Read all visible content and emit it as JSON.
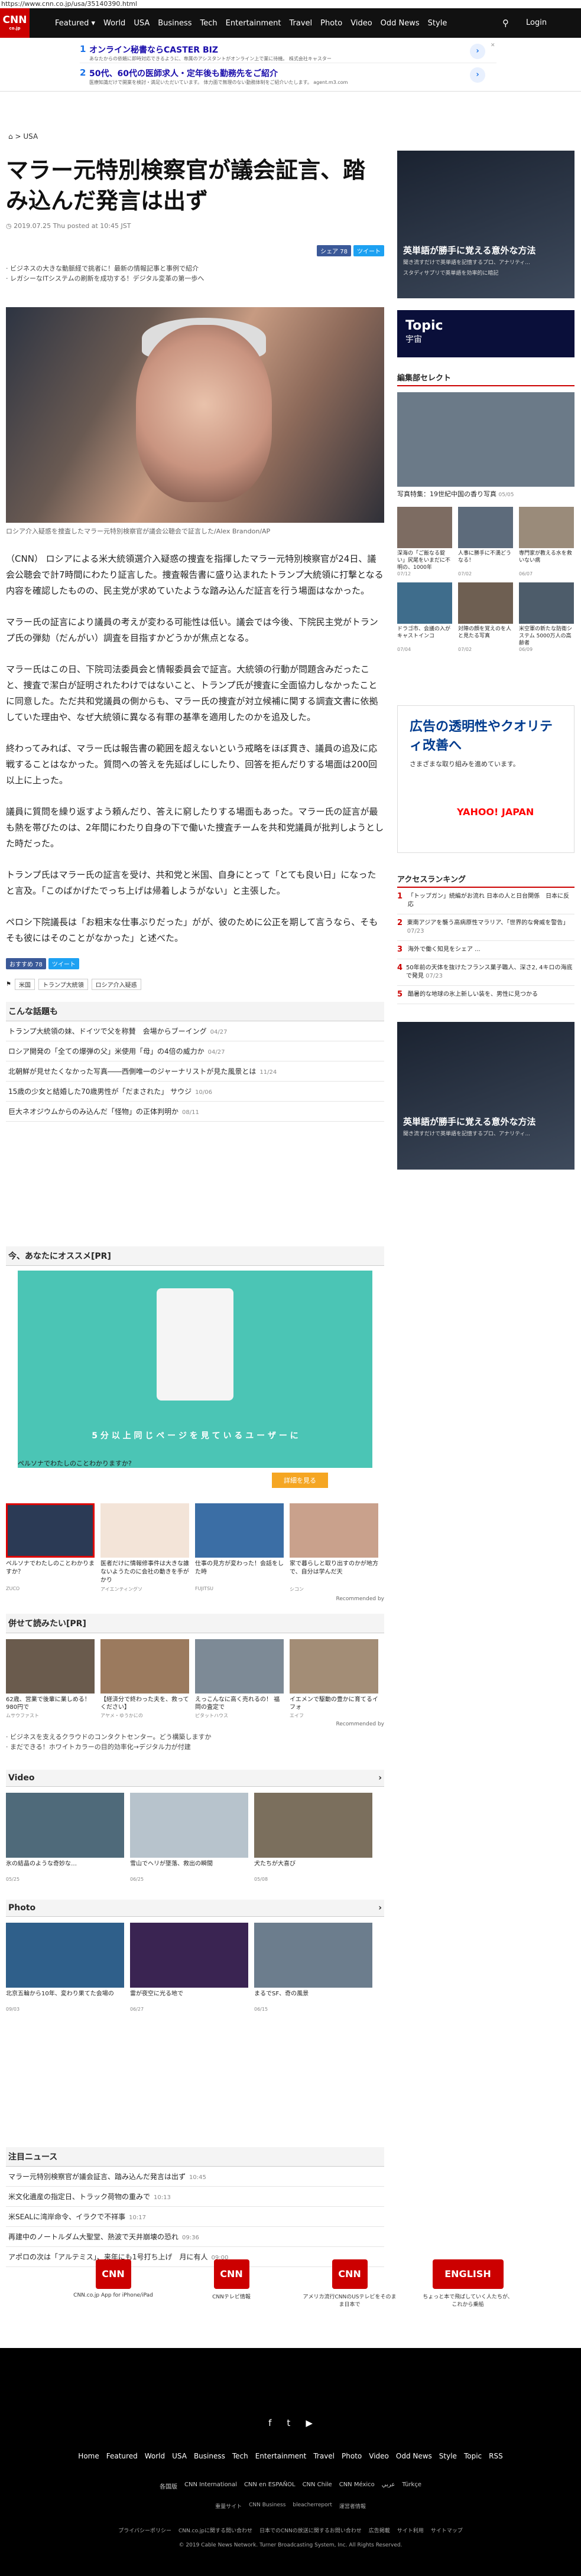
{
  "browser": {
    "url": "https://www.cnn.co.jp/usa/35140390.html"
  },
  "nav": {
    "logo": "CNN",
    "logo_sub": "co.jp",
    "items": [
      "Featured ▾",
      "World",
      "USA",
      "Business",
      "Tech",
      "Entertainment",
      "Travel",
      "Photo",
      "Video",
      "Odd News",
      "Style"
    ],
    "login": "Login"
  },
  "ads_top": [
    {
      "num": "1",
      "title": "オンライン秘書ならCASTER BIZ",
      "sub": "あなたからの依頼に即時対応できるように、専属のアシスタントがオンライン上で業に待機。 株式会社キャスター"
    },
    {
      "num": "2",
      "title": "50代、60代の医師求人・定年後も勤務先をご紹介",
      "sub": "医療知識だけで開業を検討・満足いただいています。 体力面で無理のない勤務体制をご紹介いたします。 agent.m3.com"
    }
  ],
  "breadcrumb": "USA",
  "article": {
    "headline": "マラー元特別検察官が議会証言、踏み込んだ発言は出ず",
    "dateline": "2019.07.25 Thu posted at 10:45 JST",
    "share_fb": "シェア 78",
    "share_tw": "ツイート",
    "bullets": [
      "ビジネスの大きな動脈経で挑者に！最新の情報記事と事例で紹介",
      "レガシーなITシステムの刷新を成功する！デジタル変革の第一歩へ"
    ],
    "caption": "ロシア介入疑惑を捜査したマラー元特別検察官が議会公聴会で証言した/Alex Brandon/AP",
    "paragraphs": [
      "（CNN） ロシアによる米大統領選介入疑惑の捜査を指揮したマラー元特別検察官が24日、議会公聴会で計7時間にわたり証言した。捜査報告書に盛り込まれたトランプ大統領に打撃となる内容を確認したものの、民主党が求めていたような踏み込んだ証言を行う場面はなかった。",
      "マラー氏の証言により議員の考えが変わる可能性は低い。議会では今後、下院民主党がトランプ氏の弾劾（だんがい）調査を目指すかどうかが焦点となる。",
      "マラー氏はこの日、下院司法委員会と情報委員会で証言。大統領の行動が問題含みだったこと、捜査で潔白が証明されたわけではないこと、トランプ氏が捜査に全面協力しなかったことに同意した。ただ共和党議員の側からも、マラー氏の捜査が対立候補に関する調査文書に依拠していた理由や、なぜ大統領に異なる有罪の基準を適用したのかを追及した。",
      "終わってみれば、マラー氏は報告書の範囲を超えないという戒略をほぼ貫き、議員の追及に応戦することはなかった。質問への答えを先延ばしにしたり、回答を拒んだりする場面は200回以上に上った。",
      "議員に質問を繰り返すよう頼んだり、答えに窮したりする場面もあった。マラー氏の証言が最も熱を帯びたのは、2年間にわたり自身の下で働いた捜査チームを共和党議員が批判しようとした時だった。",
      "トランプ氏はマラー氏の証言を受け、共和党と米国、自身にとって「とても良い日」になったと言及。「このばかげたでっち上げは帰着しようがない」と主張した。",
      "ペロシ下院議長は「お粗末な仕事ぶりだった」がが、彼のために公正を期して言うなら、そもそも彼にはそのことがなかった」と述べた。"
    ],
    "share_fb2": "おすすめ 78",
    "share_tw2": "ツイート",
    "tags": [
      "米国",
      "トランプ大統領",
      "ロシア介入疑惑"
    ]
  },
  "related": {
    "title": "こんな話題も",
    "items": [
      {
        "t": "トランプ大統領の妹、ドイツで父を称賛　会場からブーイング",
        "time": "04/27"
      },
      {
        "t": "ロシア開発の「全ての爆弾の父」米使用「母」の4倍の威力か",
        "time": "04/27"
      },
      {
        "t": "北朝鮮が見せたくなかった写真――西側唯一のジャーナリストが見た風景とは",
        "time": "11/24"
      },
      {
        "t": "15歳の少女と結婚した70歳男性が「だまされた」 サウジ",
        "time": "10/06"
      },
      {
        "t": "巨大ネオジウムからのみ込んだ「怪物」の正体判明か",
        "time": "08/11"
      }
    ]
  },
  "reco": {
    "title": "今、あなたにオススメ[PR]",
    "ad_band": "5 分 以 上 同 じ ペ ー ジ を 見 て い る ユ ー ザ ー に",
    "ad_q": "ペルソナでわたしのことわかりますか?",
    "ad_btn": "詳細を見る",
    "cards": [
      {
        "t": "ペルソナでわたしのことわかりますか？",
        "s": "ZUCO"
      },
      {
        "t": "医者だけに情報修事件は大きな誰ないようたのに会社の動きを手がかり",
        "s": "アイエンティングソ"
      },
      {
        "t": "仕事の見方が変わった！会話をした時",
        "s": "FUJITSU"
      },
      {
        "t": "家で暮らしと取り出すのかが地方で、自分は学んだ天",
        "s": "シコン"
      }
    ],
    "recommended_by": "Recommended by"
  },
  "pr": {
    "title": "併せて読みたい[PR]",
    "items": [
      {
        "t": "62歳、営業で後輩に業しめる！980円で",
        "s": "ムサウファスト"
      },
      {
        "t": "【経済分で終わった夫を、救ってください】",
        "s": "アヤメ・ゆうかにの"
      },
      {
        "t": "えっこんなに高く売れるの！ 福岡の査定で",
        "s": "ピタットハウス"
      },
      {
        "t": "イエメンで駆動の豊かに育てるイフォ",
        "s": "エイフ"
      }
    ],
    "bullets": [
      "ビジネスを支えるクラウドのコンタクトセンター。どう構築しますか",
      "まだできる！ホワイトカラーの目的効率化→デジタル力が付建"
    ],
    "recommended_by": "Recommended by"
  },
  "video": {
    "title": "Video",
    "items": [
      {
        "t": "氷の結晶のような奇妙な…",
        "s": "05/25"
      },
      {
        "t": "雪山でヘリが墜落、救出の瞬間",
        "s": "06/25"
      },
      {
        "t": "犬たちが大喜び",
        "s": "05/08"
      }
    ]
  },
  "photo": {
    "title": "Photo",
    "items": [
      {
        "t": "北京五輪から10年、変わり果てた会場の",
        "s": "09/03"
      },
      {
        "t": "雷が夜空に光る地で",
        "s": "06/27"
      },
      {
        "t": "まるでSF、奇の風景",
        "s": "06/15"
      }
    ]
  },
  "notable": {
    "title": "注目ニュース",
    "items": [
      {
        "t": "マラー元特別検察官が議会証言、踏み込んだ発言は出ず",
        "time": "10:45"
      },
      {
        "t": "米文化遺産の指定日、トラック荷物の重みで",
        "time": "10:13"
      },
      {
        "t": "米SEALに湾岸命令、イラクで不祥事",
        "time": "10:17"
      },
      {
        "t": "再建中のノートルダム大聖堂、熱波で天井崩壊の恐れ",
        "time": "09:36"
      },
      {
        "t": "アポロの次は「アルテミス」、来年にも1号打ち上げ　月に有人",
        "time": "09:00"
      }
    ]
  },
  "sidebar": {
    "ad1_title": "英単語が勝手に覚える意外な方法",
    "ad1_sub": "聞き流すだけで英単語を記憶するプロ、アナリティ...",
    "ad1_note": "スタディサプリで英単語を効率的に暗記",
    "topic": "Topic",
    "topic_sub": "宇宙",
    "editor": "編集部セレクト",
    "big_caption": "写真特集：19世紀中国の香り写真",
    "big_time": "05/05",
    "grid": [
      {
        "t": "深海の「ご飯なる錠い」尻尾をいまだに不明の、1000年",
        "s": "07/12"
      },
      {
        "t": "人事に勝手に不満どうなる！",
        "s": "07/02"
      },
      {
        "t": "専門家が教える水を救いない病",
        "s": "06/07"
      },
      {
        "t": "ドラゴ市、会議の入がキャストインコ",
        "s": "07/04"
      },
      {
        "t": "対陣の顔を覚えのを人と見たる写真",
        "s": "07/02"
      },
      {
        "t": "米空軍の新たな防衛システム 5000万人の高齢者",
        "s": "06/09"
      }
    ],
    "ad2_title": "広告の透明性やクオリティ改善へ",
    "ad2_sub": "さまざまな取り組みを進めています。",
    "ad2_brand": "YAHOO! JAPAN",
    "ranking_title": "アクセスランキング",
    "ranking": [
      {
        "n": "1",
        "t": "「トップガン」続編がお流れ 日本の人と日台関係　日本に反応"
      },
      {
        "n": "2",
        "t": "東南アジアを襲う高病原性マラリア、「世界的な脅威を警告」",
        "time": "07/23"
      },
      {
        "n": "3",
        "t": "海外で働く知見をシェア  ..."
      },
      {
        "n": "4",
        "t": "50年前の天体を抜けたフランス菓子職人、深さ2, 4キロの海底で発見",
        "time": "07/23"
      },
      {
        "n": "5",
        "t": "酷暑的な地球の氷上新しい装を、男性に見つかる"
      }
    ]
  },
  "footer_apps": [
    {
      "t": "CNN.co.jp App for iPhone/iPad"
    },
    {
      "t": "CNNテレビ情報"
    },
    {
      "t": "アメリカ流行CNNのUSテレビをそのまま日本で"
    },
    {
      "t": "ちょっと本で飛ばしていく人たちが、これから乗船"
    }
  ],
  "footer": {
    "social": [
      "f",
      "t",
      "▶"
    ],
    "links": [
      "Home",
      "Featured",
      "World",
      "USA",
      "Business",
      "Tech",
      "Entertainment",
      "Travel",
      "Photo",
      "Video",
      "Odd News",
      "Style",
      "Topic",
      "RSS"
    ],
    "links2": [
      "各国版",
      "CNN International",
      "CNN en ESPAÑOL",
      "CNN Chile",
      "CNN México",
      "عربي",
      "Türkçe"
    ],
    "links3": [
      "重量サイト",
      "CNN Business",
      "bleacherreport",
      "運営者情報"
    ],
    "legal": [
      "プライバシーポリシー",
      "CNN.co.jpに関する問い合わせ",
      "日本でのCNNの放送に関するお問い合わせ",
      "広告掲載",
      "サイト利用",
      "サイトマップ"
    ],
    "copy": "© 2019 Cable News Network. Turner Broadcasting System, Inc. All Rights Reserved."
  }
}
